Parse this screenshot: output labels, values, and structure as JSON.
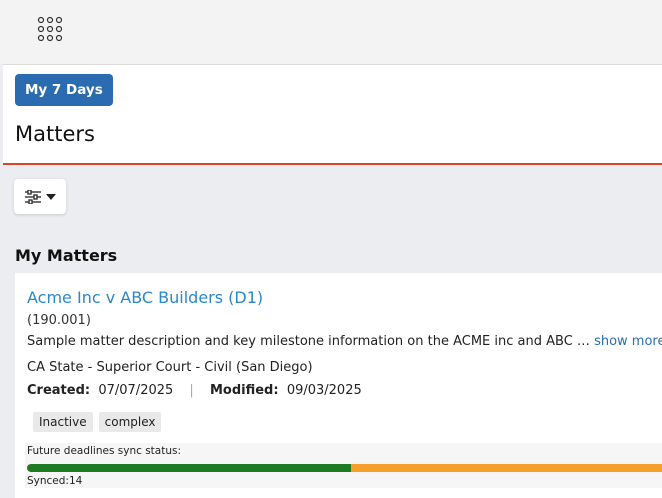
{
  "topbar": {
    "apps_icon": "grid-dots-icon"
  },
  "header": {
    "days_button": "My 7 Days",
    "title": "Matters"
  },
  "toolbar": {
    "filter_icon": "sliders-icon",
    "dropdown_icon": "caret-down-icon"
  },
  "section": {
    "title": "My Matters"
  },
  "matter": {
    "title": "Acme Inc v ABC Builders (D1)",
    "number": "(190.001)",
    "description": "Sample matter description and key milestone information on the ACME inc and ABC …",
    "show_more": "show more",
    "court": "CA State - Superior Court - Civil (San Diego)",
    "created_label": "Created:",
    "created_value": "07/07/2025",
    "separator": "|",
    "modified_label": "Modified:",
    "modified_value": "09/03/2025",
    "tags": [
      "Inactive",
      "complex"
    ],
    "sync": {
      "label": "Future deadlines sync status:",
      "synced_text": "Synced:14",
      "synced_fraction": 0.51,
      "colors": {
        "synced": "#1f7a24",
        "pending": "#f5a02a"
      }
    }
  },
  "colors": {
    "accent": "#2b6cb0",
    "link": "#2b88c8",
    "header_underline": "#d9442c"
  }
}
